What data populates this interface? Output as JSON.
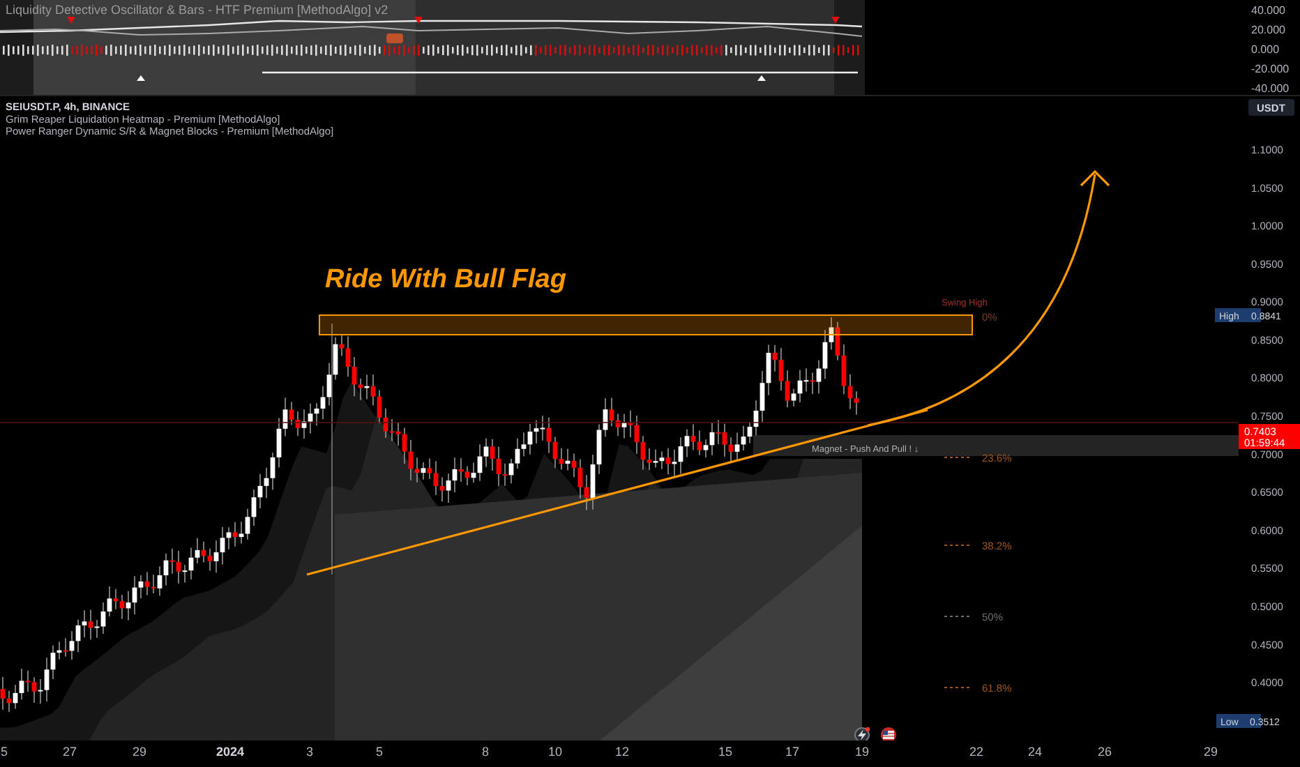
{
  "indicator_pane": {
    "title": "Liquidity Detective Oscillator & Bars - HTF Premium [MethodAlgo] v2",
    "axis_labels": [
      "40.000",
      "20.000",
      "0.000",
      "-20.000",
      "-40.000"
    ]
  },
  "legend": {
    "symbol": "SEIUSDT.P, 4h, BINANCE",
    "indicators": [
      "Grim Reaper Liquidation Heatmap - Premium [MethodAlgo]",
      "Power Ranger Dynamic S/R & Magnet Blocks - Premium [MethodAlgo]"
    ]
  },
  "currency_button": "USDT",
  "annotation": "Ride With Bull Flag",
  "swing_high": {
    "label": "Swing High",
    "level": "0%"
  },
  "magnet_label": "Magnet - Push And Pull ! ↓",
  "fib_levels": [
    {
      "label": "23.6%",
      "color": "#a0561a"
    },
    {
      "label": "38.2%",
      "color": "#a0561a"
    },
    {
      "label": "50%",
      "color": "#6e6e6e"
    },
    {
      "label": "61.8%",
      "color": "#a0561a"
    }
  ],
  "price_axis": {
    "labels": [
      "1.1000",
      "1.0500",
      "1.0000",
      "0.9500",
      "0.9000",
      "0.8500",
      "0.8000",
      "0.7500",
      "0.7000",
      "0.6500",
      "0.6000",
      "0.5500",
      "0.5000",
      "0.4500",
      "0.4000"
    ],
    "high": {
      "label": "High",
      "value": "0.8841"
    },
    "last": {
      "price": "0.7403",
      "countdown": "01:59:44"
    },
    "low": {
      "label": "Low",
      "value": "0.3512"
    }
  },
  "time_axis": [
    "5",
    "27",
    "29",
    "2024",
    "3",
    "5",
    "8",
    "10",
    "12",
    "15",
    "17",
    "19",
    "22",
    "24",
    "26",
    "29"
  ]
}
